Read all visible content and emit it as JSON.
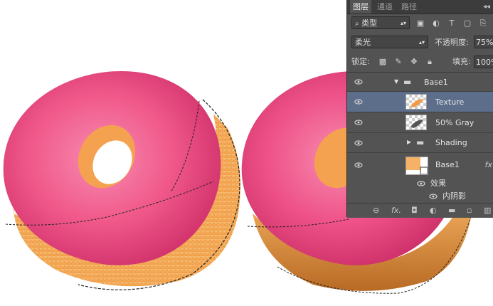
{
  "panel": {
    "tabs": [
      {
        "label": "图层",
        "active": true
      },
      {
        "label": "通道",
        "active": false
      },
      {
        "label": "路径",
        "active": false
      }
    ],
    "menu_icon": "double-chevron-icon",
    "filter": {
      "label": "类型",
      "icon": "search-icon"
    },
    "blend_mode": "柔光",
    "opacity_label": "不透明度:",
    "opacity_value": "75%",
    "lock_label": "锁定:",
    "fill_label": "填充:",
    "fill_value": "100%",
    "layers": [
      {
        "name": "Base1",
        "kind": "group",
        "expanded": true
      },
      {
        "name": "Texture",
        "kind": "layer",
        "selected": true
      },
      {
        "name": "50% Gray",
        "kind": "layer"
      },
      {
        "name": "Shading",
        "kind": "group",
        "expanded": false
      },
      {
        "name": "Base1",
        "kind": "layer",
        "has_fx": true
      }
    ],
    "fx_label": "fx",
    "effects_label": "效果",
    "inner_shadow_label": "内阴影",
    "bottom_fx_label": "fx.",
    "accent": "#5c6e8a",
    "panel_bg": "#535353"
  },
  "colors": {
    "frosting": "#e84a7a",
    "frosting_light": "#f57aa0",
    "dough": "#f5b165",
    "dough_dark": "#d98a3a"
  }
}
